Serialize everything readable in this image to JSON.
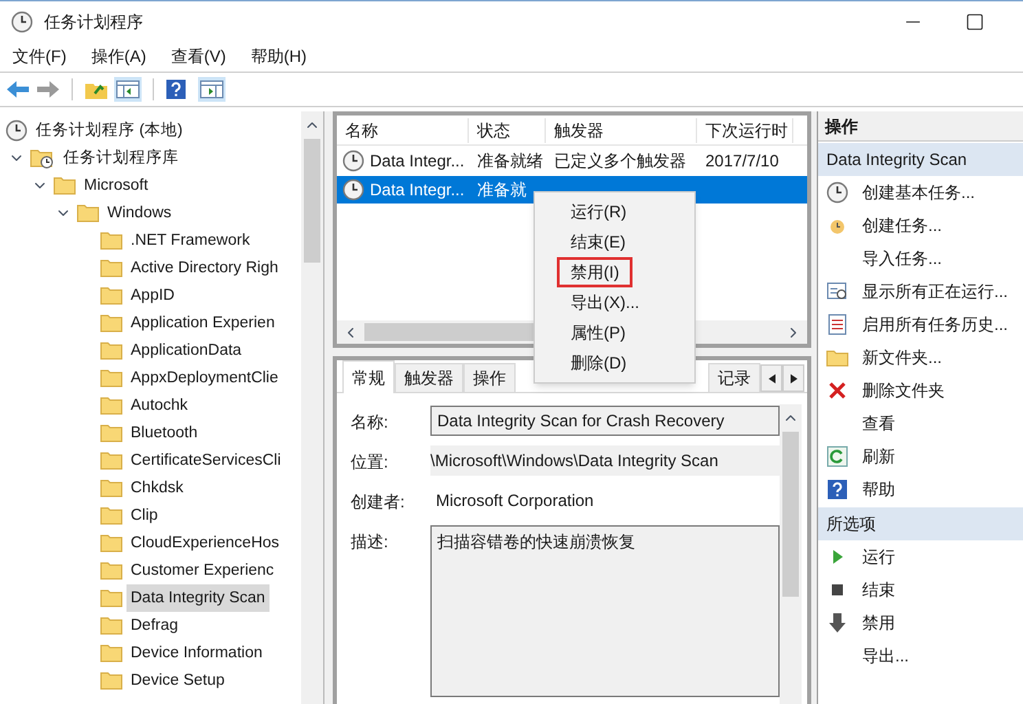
{
  "window": {
    "title": "任务计划程序"
  },
  "menu": [
    "文件(F)",
    "操作(A)",
    "查看(V)",
    "帮助(H)"
  ],
  "tree": [
    {
      "label": "任务计划程序 (本地)",
      "kind": "root",
      "selected": false,
      "children": [
        {
          "label": "任务计划程序库",
          "kind": "library",
          "expanded": true,
          "selected": false,
          "children": [
            {
              "label": "Microsoft",
              "kind": "folder",
              "expanded": true,
              "selected": false,
              "children": [
                {
                  "label": "Windows",
                  "kind": "folder",
                  "expanded": true,
                  "selected": false,
                  "children": [
                    {
                      "label": ".NET Framework",
                      "kind": "folder",
                      "selected": false
                    },
                    {
                      "label": "Active Directory Righ",
                      "kind": "folder",
                      "selected": false
                    },
                    {
                      "label": "AppID",
                      "kind": "folder",
                      "selected": false
                    },
                    {
                      "label": "Application Experien",
                      "kind": "folder",
                      "selected": false
                    },
                    {
                      "label": "ApplicationData",
                      "kind": "folder",
                      "selected": false
                    },
                    {
                      "label": "AppxDeploymentClie",
                      "kind": "folder",
                      "selected": false
                    },
                    {
                      "label": "Autochk",
                      "kind": "folder",
                      "selected": false
                    },
                    {
                      "label": "Bluetooth",
                      "kind": "folder",
                      "selected": false
                    },
                    {
                      "label": "CertificateServicesCli",
                      "kind": "folder",
                      "selected": false
                    },
                    {
                      "label": "Chkdsk",
                      "kind": "folder",
                      "selected": false
                    },
                    {
                      "label": "Clip",
                      "kind": "folder",
                      "selected": false
                    },
                    {
                      "label": "CloudExperienceHos",
                      "kind": "folder",
                      "selected": false
                    },
                    {
                      "label": "Customer Experienc",
                      "kind": "folder",
                      "selected": false
                    },
                    {
                      "label": "Data Integrity Scan",
                      "kind": "folder",
                      "selected": true
                    },
                    {
                      "label": "Defrag",
                      "kind": "folder",
                      "selected": false
                    },
                    {
                      "label": "Device Information",
                      "kind": "folder",
                      "selected": false
                    },
                    {
                      "label": "Device Setup",
                      "kind": "folder",
                      "selected": false
                    }
                  ]
                }
              ]
            }
          ]
        }
      ]
    }
  ],
  "task_list": {
    "columns": [
      "名称",
      "状态",
      "触发器",
      "下次运行时"
    ],
    "rows": [
      {
        "cells": [
          "Data Integr...",
          "准备就绪",
          "已定义多个触发器",
          "2017/7/10"
        ],
        "selected": false
      },
      {
        "cells": [
          "Data Integr...",
          "准备就"
        ],
        "selected": true
      }
    ]
  },
  "context_menu": [
    {
      "label": "运行(R)",
      "highlighted": false
    },
    {
      "label": "结束(E)",
      "highlighted": false
    },
    {
      "label": "禁用(I)",
      "highlighted": true
    },
    {
      "label": "导出(X)...",
      "highlighted": false
    },
    {
      "label": "属性(P)",
      "highlighted": false
    },
    {
      "label": "删除(D)",
      "highlighted": false
    }
  ],
  "detail_tabs": [
    {
      "label": "常规",
      "selected": true
    },
    {
      "label": "触发器",
      "selected": false
    },
    {
      "label": "操作",
      "selected": false
    },
    {
      "label": "记录",
      "selected": false
    }
  ],
  "details": [
    {
      "label": "名称:",
      "value": "Data Integrity Scan for Crash Recovery",
      "kind": "input"
    },
    {
      "label": "位置:",
      "value": "\\Microsoft\\Windows\\Data Integrity Scan",
      "kind": "readonly"
    },
    {
      "label": "创建者:",
      "value": "Microsoft Corporation",
      "kind": "text"
    },
    {
      "label": "描述:",
      "value": "扫描容错卷的快速崩溃恢复",
      "kind": "textarea"
    }
  ],
  "actions": {
    "title": "操作",
    "sections": [
      {
        "title": "Data Integrity Scan",
        "items": [
          "创建基本任务...",
          "创建任务...",
          "导入任务...",
          "显示所有正在运行...",
          "启用所有任务历史...",
          "新文件夹...",
          "删除文件夹",
          "查看",
          "刷新",
          "帮助"
        ]
      },
      {
        "title": "所选项",
        "items": [
          "运行",
          "结束",
          "禁用",
          "导出..."
        ]
      }
    ]
  }
}
